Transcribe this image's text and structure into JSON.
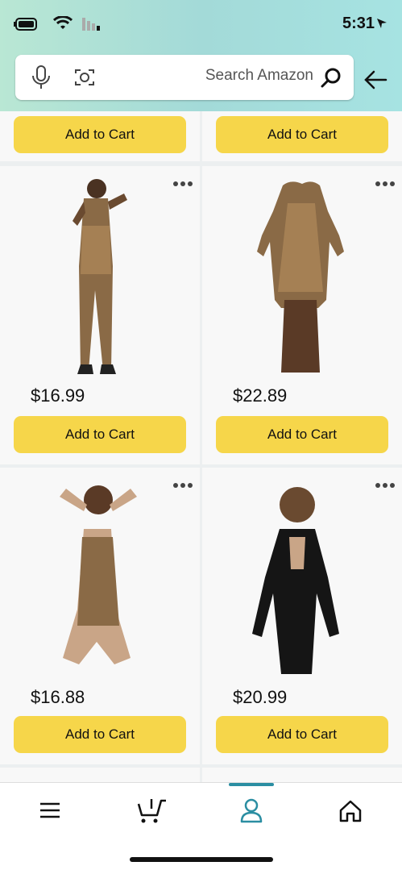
{
  "status": {
    "time": "5:31"
  },
  "search": {
    "placeholder": "Search Amazon"
  },
  "products": [
    {
      "price": "",
      "button": "Add to Cart"
    },
    {
      "price": "",
      "button": "Add to Cart"
    },
    {
      "price": "$22.89",
      "button": "Add to Cart",
      "image": "leopard-print-romper"
    },
    {
      "price": "$16.99",
      "button": "Add to Cart",
      "image": "leopard-print-jumpsuit"
    },
    {
      "price": "$20.99",
      "button": "Add to Cart",
      "image": "black-lace-bodysuit"
    },
    {
      "price": "$16.88",
      "button": "Add to Cart",
      "image": "leopard-lace-teddy"
    }
  ],
  "tabbar": {
    "items": [
      "home-icon",
      "account-icon",
      "cart-icon",
      "menu-icon"
    ],
    "active": "account-icon",
    "accent": "#2b8ea2"
  },
  "colors": {
    "button": "#f6d64a",
    "header_start": "#a6e3e2",
    "header_end": "#b9e7d4"
  }
}
